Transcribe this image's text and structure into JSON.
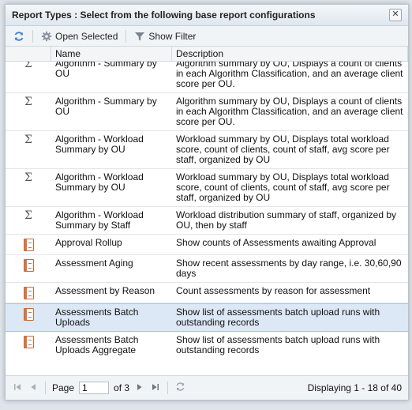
{
  "dialog": {
    "title": "Report Types : Select from the following base report configurations",
    "close_label": "✕"
  },
  "toolbar": {
    "open_selected_label": "Open Selected",
    "show_filter_label": "Show Filter"
  },
  "columns": {
    "name": "Name",
    "description": "Description"
  },
  "rows": [
    {
      "icon": "sigma",
      "name": "Algorithm - Summary by OU",
      "description": "Algorithm summary by OU, Displays a count of clients in each Algorithm Classification, and an average client score per OU.",
      "selected": false
    },
    {
      "icon": "sigma",
      "name": "Algorithm - Summary by OU",
      "description": "Algorithm summary by OU, Displays a count of clients in each Algorithm Classification, and an average client score per OU.",
      "selected": false
    },
    {
      "icon": "sigma",
      "name": "Algorithm - Workload Summary by OU",
      "description": "Workload summary by OU, Displays total workload score, count of clients, count of staff, avg score per staff, organized by OU",
      "selected": false
    },
    {
      "icon": "sigma",
      "name": "Algorithm - Workload Summary by OU",
      "description": "Workload summary by OU, Displays total workload score, count of clients, count of staff, avg score per staff, organized by OU",
      "selected": false
    },
    {
      "icon": "sigma",
      "name": "Algorithm - Workload Summary by Staff",
      "description": "Workload distribution summary of staff, organized by OU, then by staff",
      "selected": false
    },
    {
      "icon": "report",
      "name": "Approval Rollup",
      "description": "Show counts of Assessments awaiting Approval",
      "selected": false
    },
    {
      "icon": "report",
      "name": "Assessment Aging",
      "description": "Show recent assessments by day range, i.e. 30,60,90 days",
      "selected": false
    },
    {
      "icon": "report",
      "name": "Assessment by Reason",
      "description": "Count assessments by reason for assessment",
      "selected": false
    },
    {
      "icon": "report",
      "name": "Assessments Batch Uploads",
      "description": "Show list of assessments batch upload runs with outstanding records",
      "selected": true
    },
    {
      "icon": "report",
      "name": "Assessments Batch Uploads Aggregate",
      "description": "Show list of assessments batch upload runs with outstanding records",
      "selected": false
    }
  ],
  "paging": {
    "page_label": "Page",
    "page_value": "1",
    "of_label": "of 3",
    "displaying": "Displaying 1 - 18 of 40"
  }
}
